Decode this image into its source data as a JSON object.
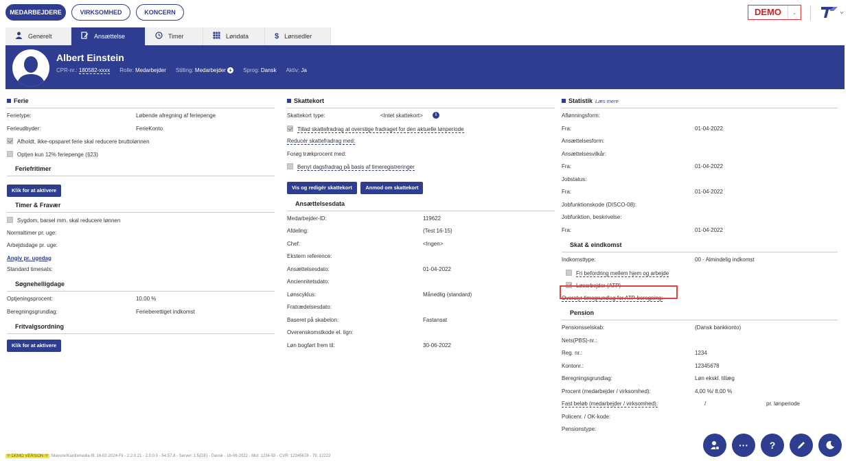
{
  "topnav": {
    "tabs": [
      "MEDARBEJDERE",
      "VIRKSOMHED",
      "KONCERN"
    ],
    "demo": "DEMO"
  },
  "tabs": [
    {
      "label": "Generelt",
      "icon": "user-icon"
    },
    {
      "label": "Ansættelse",
      "icon": "contract-icon"
    },
    {
      "label": "Timer",
      "icon": "clock-icon"
    },
    {
      "label": "Løndata",
      "icon": "table-icon"
    },
    {
      "label": "Lønsedler",
      "icon": "dollar-icon"
    }
  ],
  "employee": {
    "name": "Albert Einstein",
    "cpr_label": "CPR-nr.:",
    "cpr": "180582-xxxx",
    "role_label": "Rolle:",
    "role": "Medarbejder",
    "position_label": "Stilling:",
    "position": "Medarbejder",
    "lang_label": "Sprog:",
    "lang": "Dansk",
    "active_label": "Aktiv:",
    "active": "Ja"
  },
  "ferie": {
    "title": "Ferie",
    "type_label": "Ferietype:",
    "type": "Løbende afregning af feriepenge",
    "provider_label": "Ferieudbyder:",
    "provider": "FerieKonto",
    "cb1": "Afholdt, ikke-opsparet ferie skal reducere bruttolønnen",
    "cb2": "Optjen kun 12% feriepenge (§23)",
    "fritimer": "Feriefritimer",
    "activate": "Klik for at aktivere",
    "timer_title": "Timer & Fravær",
    "cb3": "Sygdom, barsel mm. skal reducere lønnen",
    "normal": "Normaltimer pr. uge:",
    "workdays": "Arbejdsdage pr. uge:",
    "weekday_link": "Angiv pr. ugedag",
    "std_rate": "Standard timesats:",
    "holidays_title": "Søgnehelligdage",
    "earn_label": "Optjeningsprocent:",
    "earn": "10,00 %",
    "basis_label": "Beregningsgrundlag:",
    "basis": "Ferieberettiget indkomst",
    "fritvalg": "Fritvalgsordning",
    "activate2": "Klik for at aktivere"
  },
  "skattekort": {
    "title": "Skattekort",
    "type_label": "Skattekort type:",
    "type": "<Intet skattekort>",
    "cb1": "Tillad skattefradrag at overstige fradraget for den aktuelle lønperiode",
    "reduce": "Reducér skattefradrag med:",
    "increase": "Forøg trækprocent med:",
    "cb2": "Benyt dagsfradrag på basis af timeregistreringer",
    "btn_edit": "Vis og redigér skattekort",
    "btn_request": "Anmod om skattekort"
  },
  "ansaettelse": {
    "title": "Ansættelsesdata",
    "rows": [
      {
        "k": "Medarbejder-ID:",
        "v": "119622"
      },
      {
        "k": "Afdeling:",
        "v": "(Test 16-15)"
      },
      {
        "k": "Chef:",
        "v": "<Ingen>"
      },
      {
        "k": "Ekstern reference:",
        "v": ""
      },
      {
        "k": "Ansættelsesdato:",
        "v": "01-04-2022"
      },
      {
        "k": "Anciennitetsdato:",
        "v": ""
      },
      {
        "k": "Lønscyklus:",
        "v": "Månedlig (standard)"
      },
      {
        "k": "Fratrædelsesdato:",
        "v": ""
      },
      {
        "k": "Baseret på skabelon:",
        "v": "Fastansat"
      },
      {
        "k": "Overenskomstkode el. lign:",
        "v": ""
      },
      {
        "k": "Løn bogført frem til:",
        "v": "30-06-2022"
      }
    ]
  },
  "statistik": {
    "title": "Statistik",
    "readmore": "Læs mere",
    "rows": [
      {
        "k": "Aflønningsform:",
        "v": ""
      },
      {
        "k": "Fra:",
        "v": "01-04-2022"
      },
      {
        "k": "Ansættelsesform:",
        "v": ""
      },
      {
        "k": "Ansættelsesvilkår:",
        "v": ""
      },
      {
        "k": "Fra:",
        "v": "01-04-2022"
      },
      {
        "k": "Jobstatus:",
        "v": ""
      },
      {
        "k": "Fra:",
        "v": "01-04-2022"
      },
      {
        "k": "Jobfunktionskode (DISCO-08):",
        "v": ""
      },
      {
        "k": "Jobfunktion, beskrivelse:",
        "v": ""
      },
      {
        "k": "Fra:",
        "v": "01-04-2022"
      }
    ],
    "skat_title": "Skat & eindkomst",
    "income_label": "Indkomsttype:",
    "income": "00 - Almindelig indkomst",
    "cb1": "Fri befordring mellem hjem og arbejde",
    "cb2": "Løsarbejder (ATP)",
    "override": "Overstyr timegrundlag for ATP-beregning:",
    "pension_title": "Pension",
    "pension_rows": [
      {
        "k": "Pensionsselskab:",
        "v": "(Dansk bankkonto)"
      },
      {
        "k": "Nets(PBS)-nr.:",
        "v": ""
      },
      {
        "k": "Reg. nr.:",
        "v": "1234"
      },
      {
        "k": "Kontonr.:",
        "v": "12345678"
      },
      {
        "k": "Beregningsgrundlag:",
        "v": "Løn ekskl. tillæg"
      },
      {
        "k": "Procent (medarbejder / virksomhed):",
        "v": "4,00 %/   8,00 %"
      },
      {
        "k": "Fast beløb (medarbejder / virksomhed):",
        "v": "/"
      },
      {
        "k": "Policenr. / OK-kode:",
        "v": ""
      },
      {
        "k": "Pensionstype:",
        "v": ""
      }
    ],
    "per_period": "pr. lønperiode"
  },
  "footer": {
    "tag": "!!! DEMO VERSION !!!",
    "text": "Sitecore/Kardixmedia-fil: 16-02-2024-Fil - 2.2.0.21 - 2.0.0.0 - 54.57.8 - Server: 1:5(DE) - Dansk - 16-06-2022 - Mut: 1234-55 - CVR: 12345678 - 79, 12222"
  },
  "colors": {
    "primary": "#2e3d8f",
    "accent": "#d32020"
  }
}
